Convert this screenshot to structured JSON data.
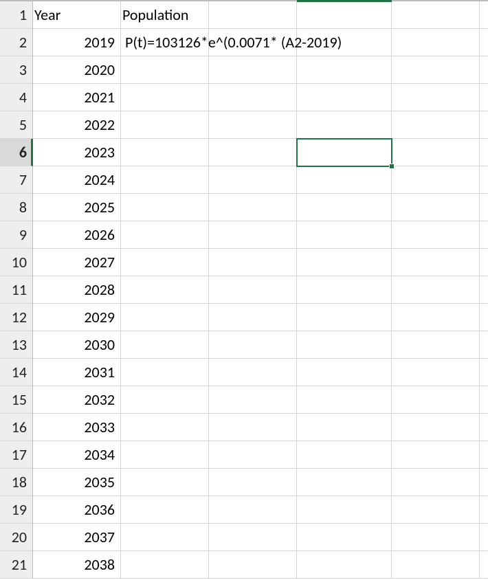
{
  "headers": {
    "colA": "Year",
    "colB": "Population"
  },
  "formula_display": "P(t)=103126*e^(0.0071* (A2-2019)",
  "rows": [
    {
      "n": "1",
      "a": "Year",
      "b": "Population",
      "isHeader": true
    },
    {
      "n": "2",
      "a": "2019",
      "b": "P(t)=103126*e^(0.0071* (A2-2019)"
    },
    {
      "n": "3",
      "a": "2020",
      "b": ""
    },
    {
      "n": "4",
      "a": "2021",
      "b": ""
    },
    {
      "n": "5",
      "a": "2022",
      "b": ""
    },
    {
      "n": "6",
      "a": "2023",
      "b": ""
    },
    {
      "n": "7",
      "a": "2024",
      "b": ""
    },
    {
      "n": "8",
      "a": "2025",
      "b": ""
    },
    {
      "n": "9",
      "a": "2026",
      "b": ""
    },
    {
      "n": "10",
      "a": "2027",
      "b": ""
    },
    {
      "n": "11",
      "a": "2028",
      "b": ""
    },
    {
      "n": "12",
      "a": "2029",
      "b": ""
    },
    {
      "n": "13",
      "a": "2030",
      "b": ""
    },
    {
      "n": "14",
      "a": "2031",
      "b": ""
    },
    {
      "n": "15",
      "a": "2032",
      "b": ""
    },
    {
      "n": "16",
      "a": "2033",
      "b": ""
    },
    {
      "n": "17",
      "a": "2034",
      "b": ""
    },
    {
      "n": "18",
      "a": "2035",
      "b": ""
    },
    {
      "n": "19",
      "a": "2036",
      "b": ""
    },
    {
      "n": "20",
      "a": "2037",
      "b": ""
    },
    {
      "n": "21",
      "a": "2038",
      "b": ""
    }
  ],
  "active_row": "6",
  "selection": {
    "col": "D",
    "row": 6
  }
}
